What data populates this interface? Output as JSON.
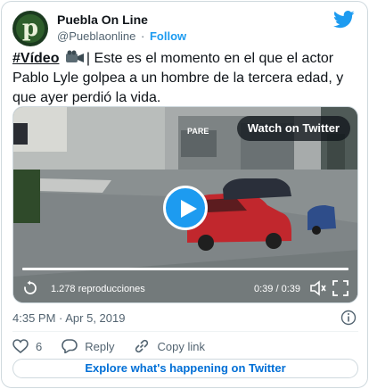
{
  "account": {
    "name": "Puebla On Line",
    "handle": "@Pueblaonline",
    "separator": "·",
    "follow_label": "Follow",
    "avatar_letter": "p"
  },
  "tweet": {
    "hashtag": "#Vídeo",
    "text": "| Este es el momento en el que el actor Pablo Lyle golpea a un hombre de la tercera edad, y que ayer perdió la vida.",
    "timestamp": "4:35 PM · Apr 5, 2019"
  },
  "video": {
    "watch_label": "Watch on Twitter",
    "views": "1.278 reproducciones",
    "time": "0:39 / 0:39",
    "progress": 1.0,
    "sign_text": "PARE"
  },
  "actions": {
    "likes": "6",
    "reply_label": "Reply",
    "copy_label": "Copy link"
  },
  "explore_label": "Explore what's happening on Twitter",
  "colors": {
    "accent": "#1d9bf0",
    "text": "#0f1419",
    "secondary": "#536471",
    "border": "#cfd9de"
  },
  "icons": [
    "twitter-bird-icon",
    "video-camera-icon",
    "play-icon",
    "replay-icon",
    "volume-icon",
    "fullscreen-icon",
    "info-icon",
    "heart-icon",
    "reply-icon",
    "link-icon"
  ]
}
